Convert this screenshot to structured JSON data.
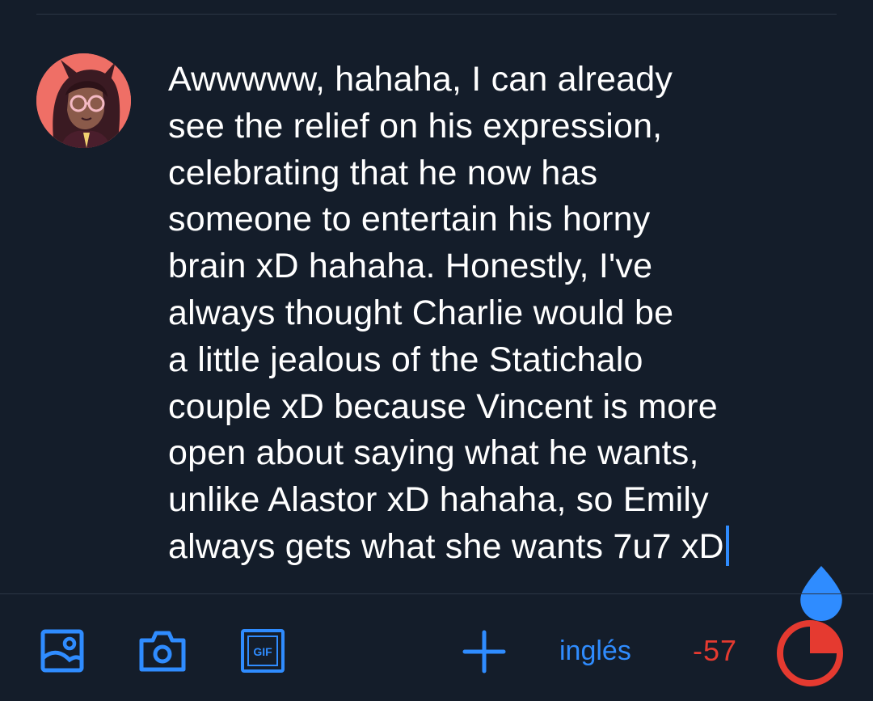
{
  "compose": {
    "lines": [
      "Awwwww, hahaha, I can already",
      "see the relief on his expression,",
      "celebrating that he now has",
      "someone to entertain his horny",
      "brain xD hahaha. Honestly, I've",
      "always thought Charlie would be",
      "a little jealous of the Statichalo",
      "couple xD because Vincent is more",
      "open about saying what he wants,",
      "unlike Alastor xD hahaha, so Emily",
      "always gets what she wants 7u7 xD"
    ]
  },
  "toolbar": {
    "image_icon": "image-icon",
    "camera_icon": "camera-icon",
    "gif_icon": "gif-icon",
    "gif_label": "GIF",
    "add_icon": "plus-icon",
    "language_label": "inglés",
    "char_count": "-57",
    "char_limit_progress": 1.0
  },
  "colors": {
    "background": "#141d2a",
    "accent": "#2f8cff",
    "text": "#ffffff",
    "over_limit": "#e53a30",
    "avatar_bg": "#ef6f66",
    "divider": "#2b3645"
  }
}
